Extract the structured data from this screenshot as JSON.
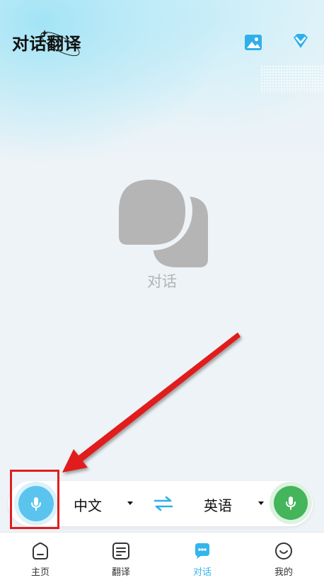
{
  "header": {
    "title": "对话翻译",
    "image_icon": "image-icon",
    "vip_icon": "diamond-icon"
  },
  "empty_state": {
    "icon": "chat-bubbles-icon",
    "label": "对话"
  },
  "language_bar": {
    "source_language": "中文",
    "target_language": "英语",
    "swap_icon": "swap-arrows-icon",
    "left_mic_icon": "microphone-icon",
    "right_mic_icon": "microphone-icon"
  },
  "bottom_nav": {
    "items": [
      {
        "label": "主页",
        "icon": "home-icon"
      },
      {
        "label": "翻译",
        "icon": "document-icon"
      },
      {
        "label": "对话",
        "icon": "chat-icon",
        "active": true
      },
      {
        "label": "我的",
        "icon": "smile-icon"
      }
    ]
  },
  "colors": {
    "accent": "#34b5ec",
    "left_mic": "#5ac4ee",
    "right_mic": "#44b55a",
    "annotation": "#e01e1e"
  }
}
